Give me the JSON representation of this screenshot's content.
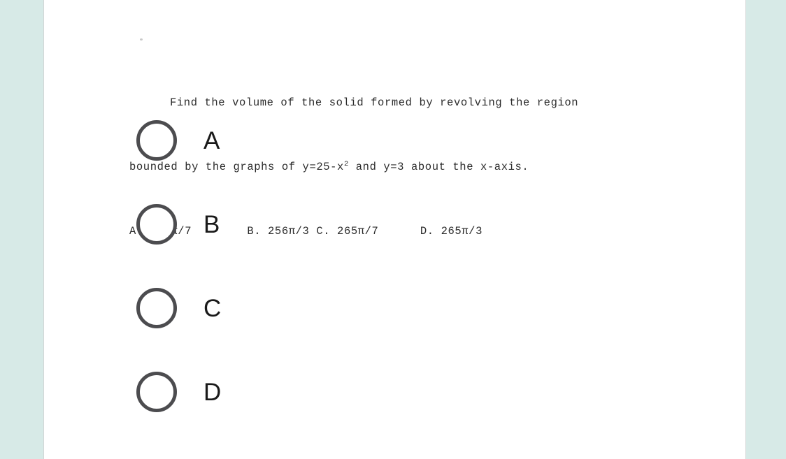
{
  "colors": {
    "page_background": "#d7eae7",
    "card_background": "#ffffff",
    "card_border": "#d2d6d6",
    "radio_border": "#4c4c4f",
    "question_text": "#2b2b2b",
    "option_text": "#1a1a1a"
  },
  "question": {
    "line1": "Find the volume of the solid formed by revolving the region",
    "line2_pre": "bounded by the graphs of y=25-x",
    "line2_sup": "2",
    "line2_post": " and y=3 about the x-axis.",
    "line3": "A. 256π/7        B. 256π/3 C. 265π/7      D. 265π/3",
    "choices_inline": [
      {
        "key": "A",
        "value": "256π/7"
      },
      {
        "key": "B",
        "value": "256π/3"
      },
      {
        "key": "C",
        "value": "265π/7"
      },
      {
        "key": "D",
        "value": "265π/3"
      }
    ]
  },
  "options": [
    {
      "label": "A",
      "selected": false
    },
    {
      "label": "B",
      "selected": false
    },
    {
      "label": "C",
      "selected": false
    },
    {
      "label": "D",
      "selected": false
    }
  ]
}
